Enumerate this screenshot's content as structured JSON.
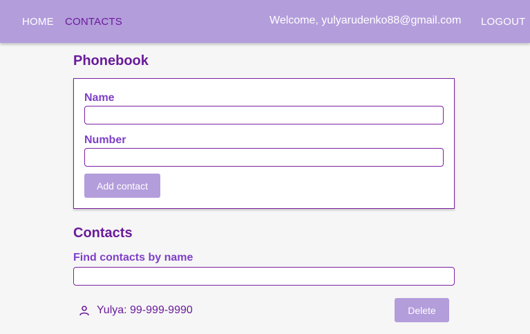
{
  "nav": {
    "home": "HOME",
    "contacts": "CONTACTS",
    "welcome": "Welcome, yulyarudenko88@gmail.com",
    "logout": "LOGOUT"
  },
  "phonebook": {
    "title": "Phonebook",
    "name_label": "Name",
    "name_value": "",
    "number_label": "Number",
    "number_value": "",
    "add_button": "Add contact"
  },
  "contacts": {
    "title": "Contacts",
    "filter_label": "Find contacts by name",
    "filter_value": "",
    "items": [
      {
        "text": "Yulya: 99-999-9990",
        "icon": "person-icon",
        "delete_label": "Delete"
      }
    ]
  },
  "colors": {
    "appbar": "#b39ddb",
    "accent": "#6a1b9a",
    "button": "#b39ddb",
    "background": "#f6f6f6"
  }
}
